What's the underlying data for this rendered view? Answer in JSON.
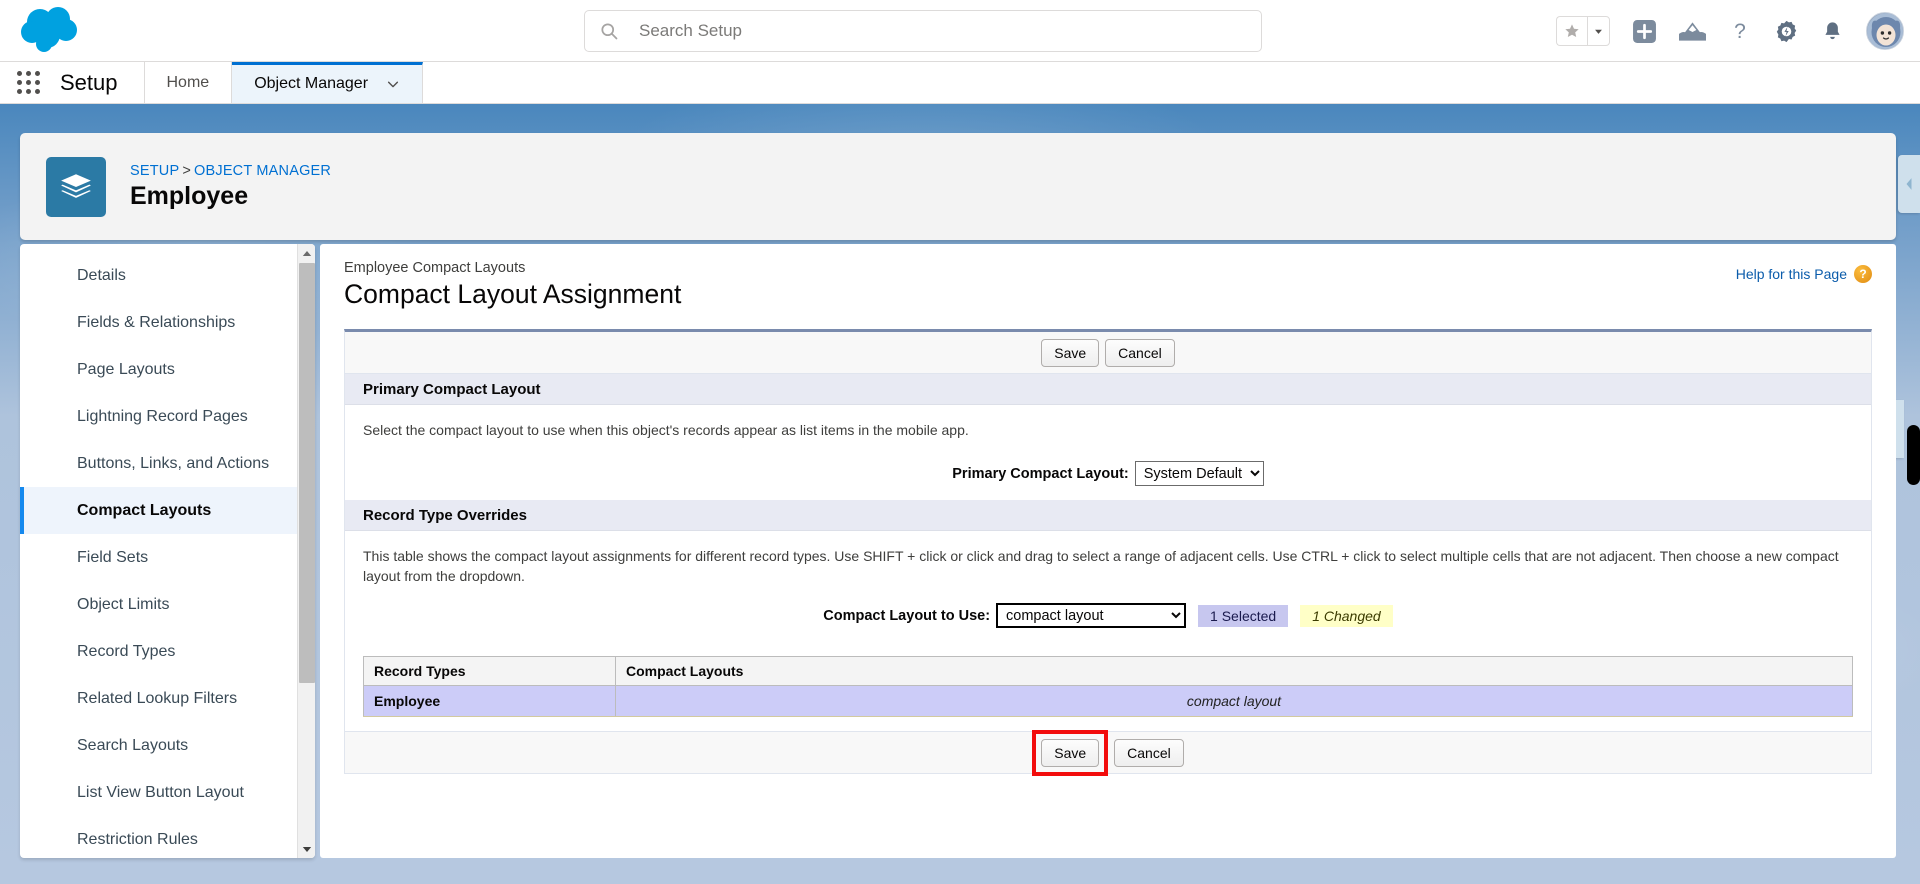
{
  "global_header": {
    "logo": "salesforce-cloud-logo",
    "search": {
      "placeholder": "Search Setup",
      "value": "",
      "icon": "search-icon"
    },
    "icons": [
      {
        "name": "favorites-star-icon",
        "glyph": "star"
      },
      {
        "name": "favorites-dropdown-icon",
        "glyph": "caret-down"
      },
      {
        "name": "global-actions-icon",
        "glyph": "plus-square"
      },
      {
        "name": "setup-assistant-icon",
        "glyph": "mountain"
      },
      {
        "name": "help-icon",
        "glyph": "question-mark"
      },
      {
        "name": "setup-gear-icon",
        "glyph": "gear"
      },
      {
        "name": "notifications-bell-icon",
        "glyph": "bell"
      },
      {
        "name": "user-avatar",
        "glyph": "astro-avatar"
      }
    ]
  },
  "setup_bar": {
    "app_launcher_icon": "waffle-grid-icon",
    "title": "Setup",
    "tabs": [
      {
        "label": "Home",
        "active": false,
        "has_caret": false
      },
      {
        "label": "Object Manager",
        "active": true,
        "has_caret": true
      }
    ]
  },
  "record_header": {
    "icon": "layers-object-icon",
    "breadcrumb": {
      "setup": "SETUP",
      "separator": ">",
      "object_manager": "OBJECT MANAGER"
    },
    "title": "Employee"
  },
  "sidebar": {
    "items": [
      {
        "label": "Details",
        "active": false
      },
      {
        "label": "Fields & Relationships",
        "active": false
      },
      {
        "label": "Page Layouts",
        "active": false
      },
      {
        "label": "Lightning Record Pages",
        "active": false
      },
      {
        "label": "Buttons, Links, and Actions",
        "active": false
      },
      {
        "label": "Compact Layouts",
        "active": true
      },
      {
        "label": "Field Sets",
        "active": false
      },
      {
        "label": "Object Limits",
        "active": false
      },
      {
        "label": "Record Types",
        "active": false
      },
      {
        "label": "Related Lookup Filters",
        "active": false
      },
      {
        "label": "Search Layouts",
        "active": false
      },
      {
        "label": "List View Button Layout",
        "active": false
      },
      {
        "label": "Restriction Rules",
        "active": false
      }
    ],
    "scrollbar": {
      "up_arrow_icon": "scroll-up-arrow-icon",
      "down_arrow_icon": "scroll-down-arrow-icon"
    }
  },
  "main": {
    "eyebrow": "Employee Compact Layouts",
    "heading": "Compact Layout Assignment",
    "help_link": {
      "label": "Help for this Page",
      "icon": "help-question-icon"
    },
    "toolbar_top": {
      "save_label": "Save",
      "cancel_label": "Cancel"
    },
    "toolbar_bottom": {
      "save_label": "Save",
      "cancel_label": "Cancel",
      "save_highlighted": true,
      "highlight_color": "#f20c0c"
    },
    "primary_section": {
      "heading": "Primary Compact Layout",
      "description": "Select the compact layout to use when this object's records appear as list items in the mobile app.",
      "field_label": "Primary Compact Layout:",
      "field_value": "System Default"
    },
    "overrides_section": {
      "heading": "Record Type Overrides",
      "description": "This table shows the compact layout assignments for different record types. Use SHIFT + click or click and drag to select a range of adjacent cells. Use CTRL + click to select multiple cells that are not adjacent. Then choose a new compact layout from the dropdown.",
      "use_label": "Compact Layout to Use:",
      "use_value": "compact layout",
      "badge_selected": "1 Selected",
      "badge_changed": "1 Changed",
      "badge_selected_color": "#c7c7ef",
      "badge_changed_color": "#ffffc7",
      "table": {
        "columns": [
          "Record Types",
          "Compact Layouts"
        ],
        "rows": [
          {
            "record_type": "Employee",
            "compact_layout": "compact layout",
            "selected": true
          }
        ]
      }
    }
  },
  "right_rail": {
    "collapse_icon_top": "collapse-left-arrow-icon",
    "collapse_icon_bottom": "collapse-left-arrow-icon"
  }
}
